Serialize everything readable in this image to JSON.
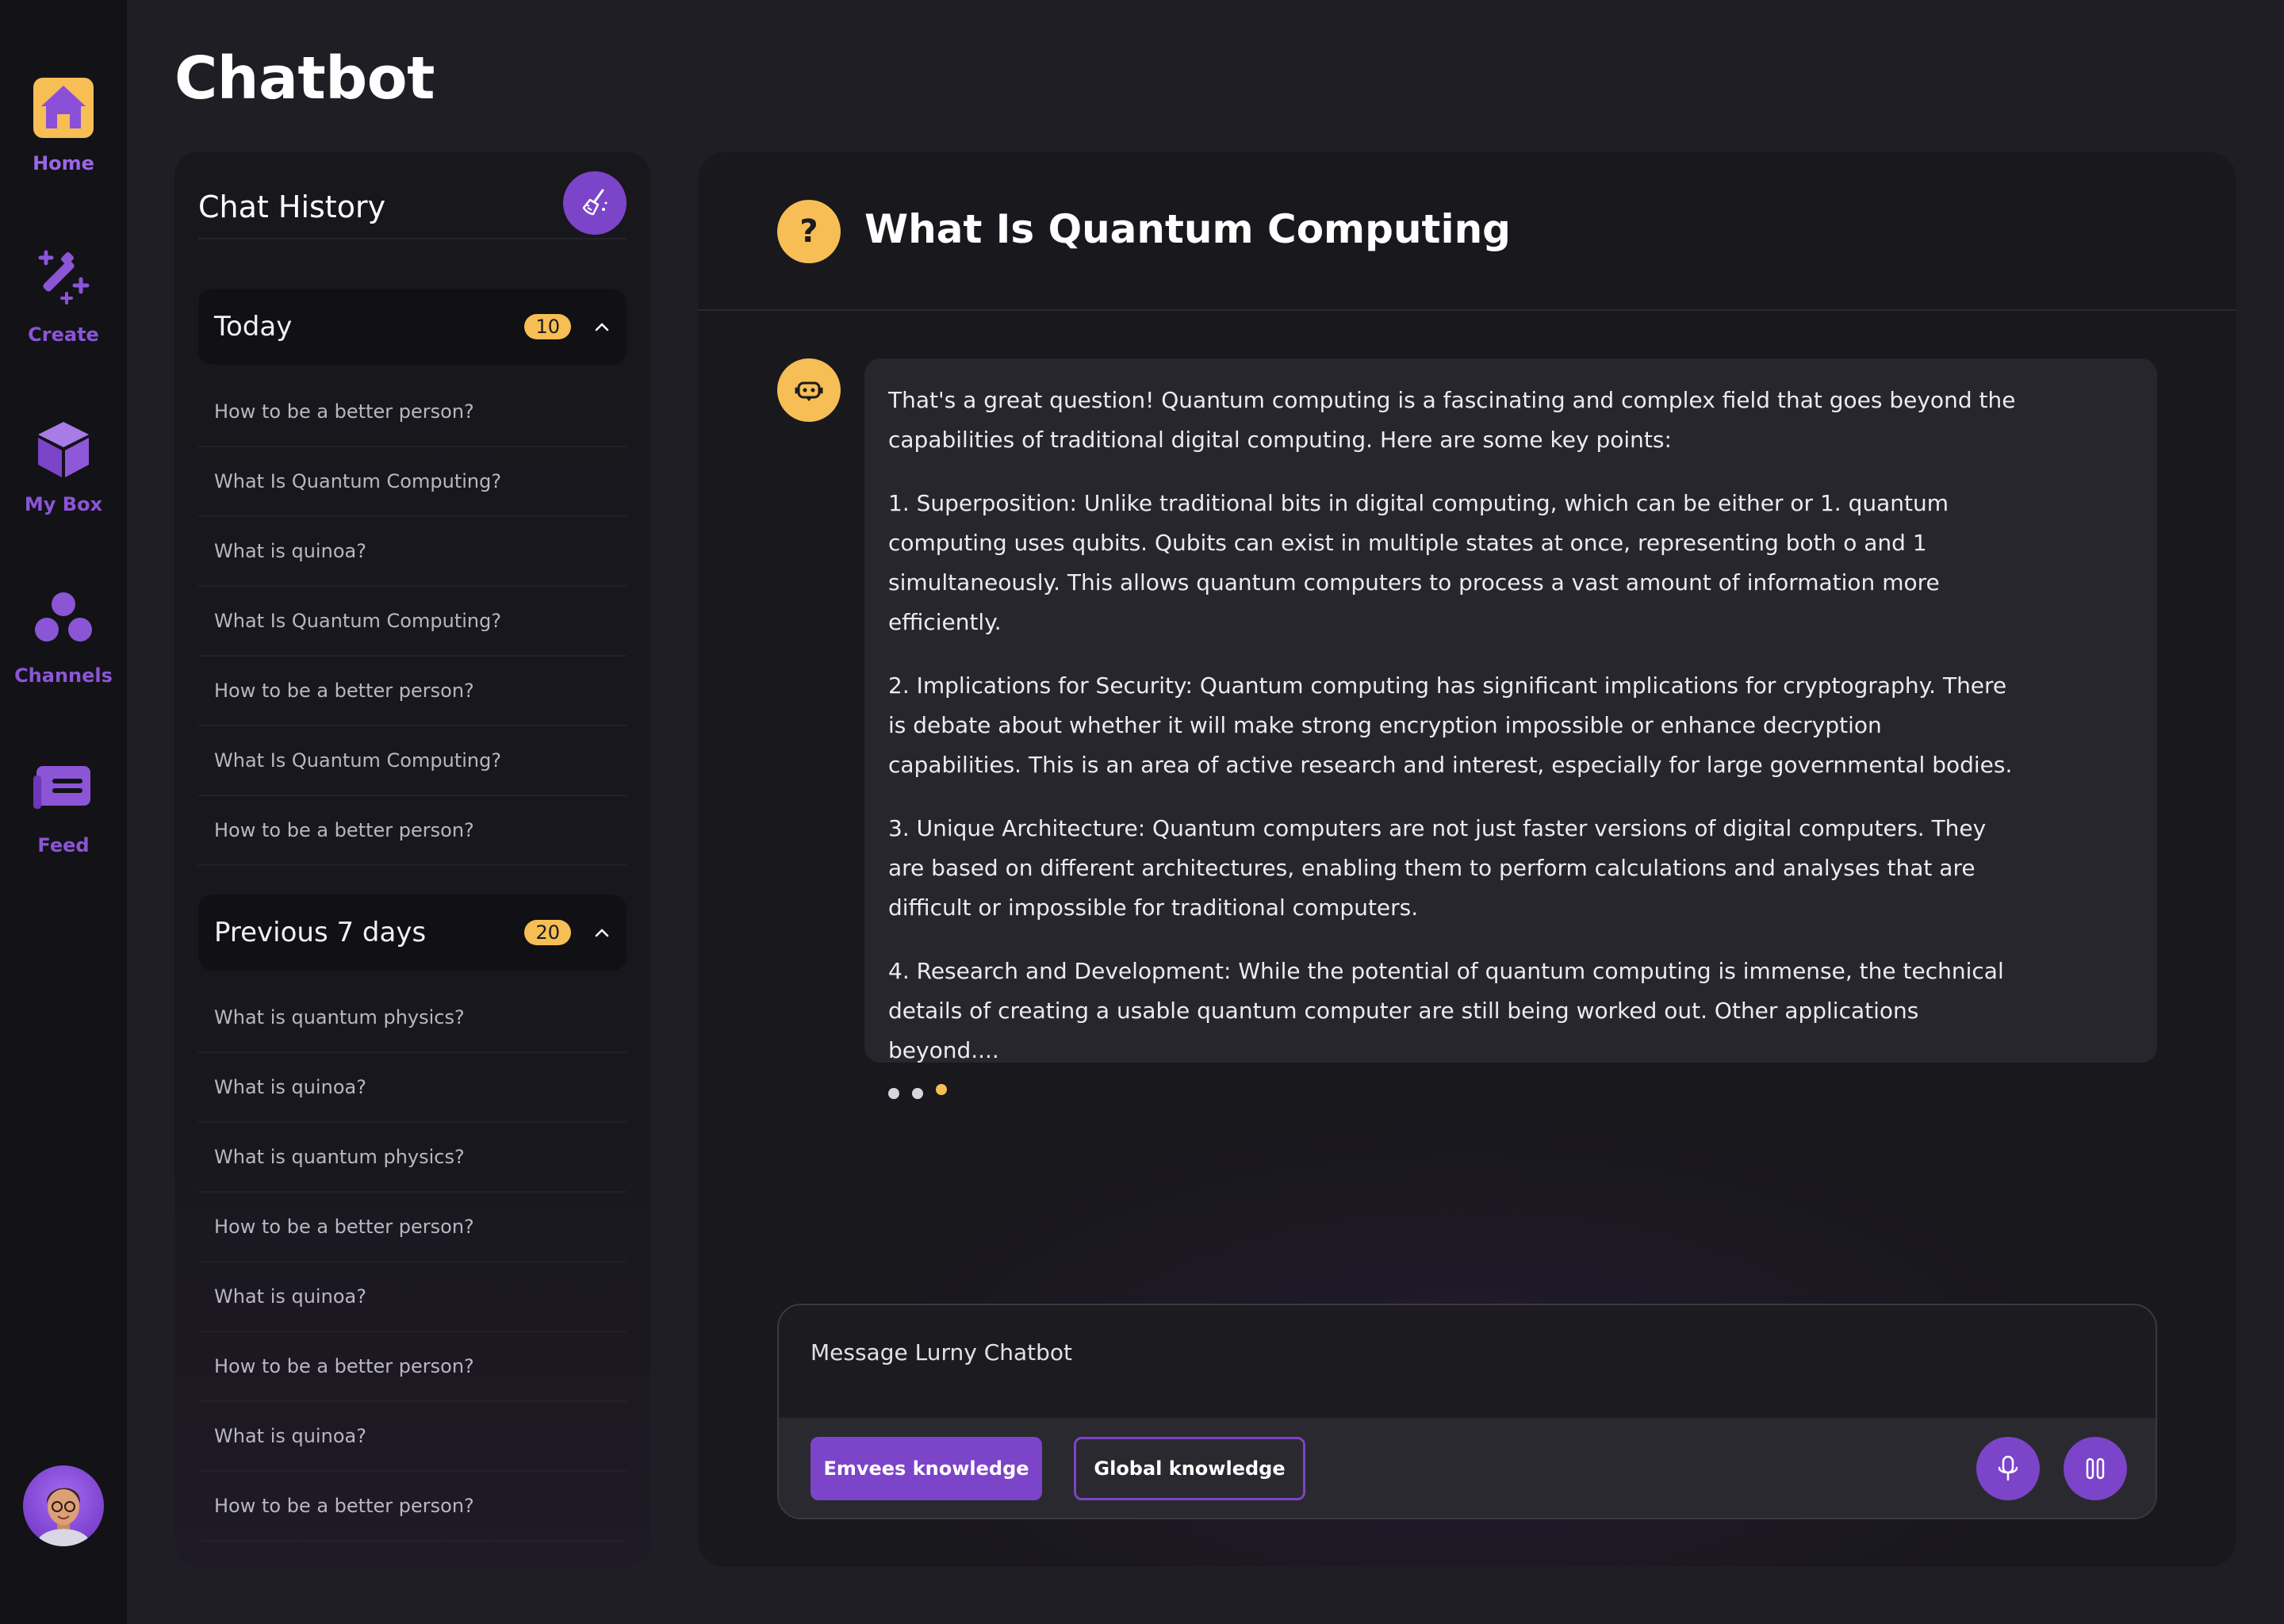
{
  "app": {
    "title": "Chatbot"
  },
  "nav": {
    "items": [
      {
        "label": "Home",
        "icon": "home-icon"
      },
      {
        "label": "Create",
        "icon": "magic-wand-icon"
      },
      {
        "label": "My Box",
        "icon": "box-icon"
      },
      {
        "label": "Channels",
        "icon": "channels-icon"
      },
      {
        "label": "Feed",
        "icon": "feed-icon"
      }
    ],
    "active": "Home"
  },
  "history": {
    "title": "Chat History",
    "clear_icon": "broom-icon",
    "groups": [
      {
        "label": "Today",
        "count": "10",
        "expanded": true,
        "items": [
          "How to be a better person?",
          "What Is Quantum Computing?",
          "What is quinoa?",
          "What Is Quantum Computing?",
          "How to be a better person?",
          "What Is Quantum Computing?",
          "How to be a better person?"
        ]
      },
      {
        "label": "Previous 7 days",
        "count": "20",
        "expanded": true,
        "items": [
          "What is quantum physics?",
          "What is quinoa?",
          "What is quantum physics?",
          "How to be a better person?",
          "What is quinoa?",
          "How to be a better person?",
          "What is quinoa?",
          "How to be a better person?"
        ]
      }
    ]
  },
  "chat": {
    "title": "What Is Quantum Computing",
    "title_icon": "question-icon",
    "bot_icon": "bot-icon",
    "message": {
      "intro": "That's a great question! Quantum computing is a fascinating and complex field that goes beyond the capabilities of traditional digital computing. Here are some key points:",
      "points": [
        "1. Superposition: Unlike traditional bits in digital computing, which can be either or 1. quantum computing uses qubits. Qubits can exist in multiple states at once, representing both o and 1 simultaneously. This allows quantum computers to process a vast amount of information more efficiently.",
        "2. Implications for Security: Quantum computing has significant implications for cryptography. There is debate about whether it will make strong encryption impossible or enhance decryption capabilities. This is an area of active research and interest, especially for large governmental bodies.",
        "3. Unique Architecture: Quantum computers are not just faster versions of digital computers. They are based on different architectures, enabling them to perform calculations and analyses that are difficult or impossible for traditional computers.",
        "4. Research and Development: While the potential of quantum computing is immense, the technical details of creating a usable quantum computer are still being worked out. Other applications beyond...."
      ]
    }
  },
  "composer": {
    "placeholder": "Message Lurny Chatbot",
    "value": "",
    "emvees_label": "Emvees knowledge",
    "global_label": "Global knowledge",
    "mic_icon": "microphone-icon",
    "pause_icon": "pause-icon"
  },
  "colors": {
    "accent": "#7c44c9",
    "highlight": "#f6be54",
    "background": "#1f1e24",
    "nav": "#131216"
  }
}
